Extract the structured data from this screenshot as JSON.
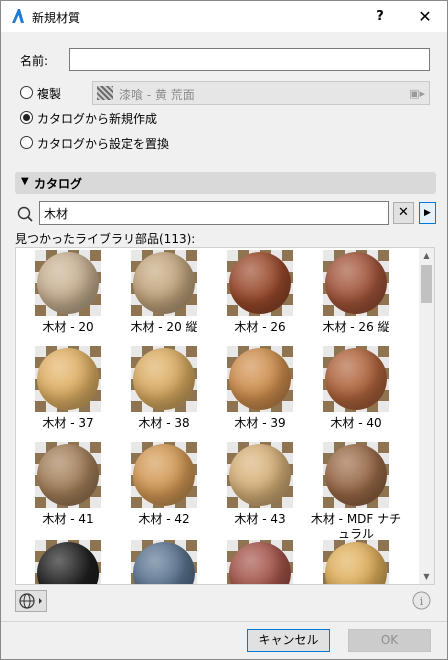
{
  "window": {
    "title": "新規材質",
    "help": "?",
    "close": "✕"
  },
  "form": {
    "name_label": "名前:",
    "name_value": "",
    "options": [
      {
        "label": "複製",
        "checked": false
      },
      {
        "label": "カタログから新規作成",
        "checked": true
      },
      {
        "label": "カタログから設定を置換",
        "checked": false
      }
    ],
    "duplicate_value": "漆喰 - 黄 荒面"
  },
  "catalog": {
    "header": "カタログ",
    "search_value": "木材",
    "found_label": "見つかったライブラリ部品(113):",
    "items": [
      {
        "name": "木材 - 20",
        "color": "#c9b293"
      },
      {
        "name": "木材 - 20 縦",
        "color": "#c4a77f"
      },
      {
        "name": "木材 - 26",
        "color": "#9b4a2c"
      },
      {
        "name": "木材 - 26 縦",
        "color": "#a3553a"
      },
      {
        "name": "木材 - 37",
        "color": "#e2b266"
      },
      {
        "name": "木材 - 38",
        "color": "#dcae63"
      },
      {
        "name": "木材 - 39",
        "color": "#d08f4e"
      },
      {
        "name": "木材 - 40",
        "color": "#b0643c"
      },
      {
        "name": "木材 - 41",
        "color": "#a4805a"
      },
      {
        "name": "木材 - 42",
        "color": "#d49a55"
      },
      {
        "name": "木材 - 43",
        "color": "#d8b27a"
      },
      {
        "name": "木材 - MDF ナチュラル",
        "color": "#9a6a47"
      },
      {
        "name": "",
        "color": "#1f1f1f"
      },
      {
        "name": "",
        "color": "#5a7490"
      },
      {
        "name": "",
        "color": "#a4544a"
      },
      {
        "name": "",
        "color": "#e0b05c"
      }
    ]
  },
  "footer": {
    "cancel_label": "キャンセル",
    "ok_label": "OK"
  },
  "colors": {
    "accent": "#0078d7",
    "section_bg": "#d9d9d9",
    "window_bg": "#f0f0f0"
  }
}
